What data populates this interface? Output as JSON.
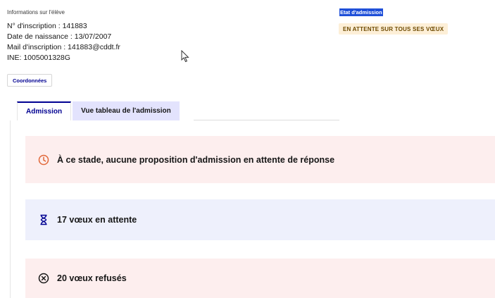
{
  "student": {
    "section_title": "Informations sur l'élève",
    "inscription": "N° d'inscription : 141883",
    "birthdate": "Date de naissance : 13/07/2007",
    "email": "Mail d'inscription : 141883@cddt.fr",
    "ine": "INE: 1005001328G",
    "coords_button": "Coordonnées"
  },
  "admission_state": {
    "label": "Etat d'admission",
    "badge": "EN ATTENTE SUR TOUS SES VŒUX"
  },
  "tabs": [
    {
      "label": "Admission",
      "active": true
    },
    {
      "label": "Vue tableau de l'admission",
      "active": false
    }
  ],
  "cards": [
    {
      "icon": "clock-icon",
      "text": "À ce stade, aucune proposition d'admission en attente de réponse",
      "color": "#fdeeee"
    },
    {
      "icon": "hourglass-icon",
      "text": "17 vœux en attente",
      "color": "#eef0fc"
    },
    {
      "icon": "cross-circle-icon",
      "text": "20 vœux refusés",
      "color": "#fdeeee"
    }
  ],
  "colors": {
    "accent": "#000091",
    "alert_icon": "#e1683a",
    "badge_bg": "#fdefd7"
  }
}
